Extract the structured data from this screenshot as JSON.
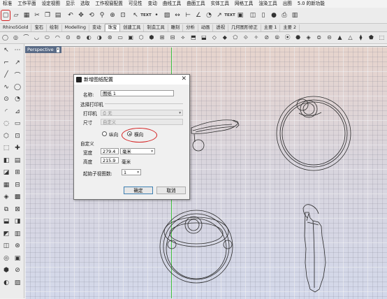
{
  "menubar": {
    "items": [
      "标准",
      "工作平面",
      "设定视图",
      "显示",
      "选取",
      "工作视窗配置",
      "可见性",
      "变动",
      "曲线工具",
      "曲面工具",
      "实体工具",
      "网格工具",
      "渲染工具",
      "出图",
      "5.0 的新功能"
    ]
  },
  "toolbar": {
    "buttons": [
      {
        "icon": "new-file-icon",
        "glyph": "▢"
      },
      {
        "icon": "open-file-icon",
        "glyph": "▱"
      },
      {
        "icon": "save-icon",
        "glyph": "▦"
      },
      {
        "icon": "cut-icon",
        "glyph": "✂"
      },
      {
        "icon": "copy-icon",
        "glyph": "❐"
      },
      {
        "icon": "paste-icon",
        "glyph": "▤"
      },
      {
        "icon": "undo-icon",
        "glyph": "↶"
      },
      {
        "icon": "pan-icon",
        "glyph": "✥"
      },
      {
        "icon": "rotate-view-icon",
        "glyph": "⟲"
      },
      {
        "icon": "zoom-icon",
        "glyph": "⚲"
      },
      {
        "icon": "zoom-extents-icon",
        "glyph": "⊕"
      },
      {
        "icon": "zoom-window-icon",
        "glyph": "⊡"
      },
      {
        "icon": "select-icon",
        "glyph": "↖"
      },
      {
        "icon": "text-icon",
        "glyph": "TEXT"
      },
      {
        "icon": "dot-icon",
        "glyph": "•"
      },
      {
        "icon": "hatch-icon",
        "glyph": "▨"
      },
      {
        "icon": "dimension-icon",
        "glyph": "↔"
      },
      {
        "icon": "linear-dimension-icon",
        "glyph": "⊢"
      },
      {
        "icon": "angle-icon",
        "glyph": "∠"
      },
      {
        "icon": "radius-icon",
        "glyph": "◔"
      },
      {
        "icon": "leader-icon",
        "glyph": "↗"
      },
      {
        "icon": "text-field-icon",
        "glyph": "TEXT"
      },
      {
        "icon": "block-icon",
        "glyph": "▣"
      },
      {
        "icon": "detail-icon",
        "glyph": "◫"
      },
      {
        "icon": "layout-icon",
        "glyph": "▯"
      },
      {
        "icon": "material-icon",
        "glyph": "●"
      },
      {
        "icon": "print-icon",
        "glyph": "⎙"
      },
      {
        "icon": "print-setup-icon",
        "glyph": "▥"
      }
    ]
  },
  "tabs": [
    "Rhino5Gold",
    "宝石",
    "绘制",
    "Modelling",
    "变动",
    "珠宝",
    "创建工具",
    "制造工具",
    "雕刻",
    "分析",
    "动画",
    "透视",
    "几何图形修正",
    "主要 1",
    "主要 2"
  ],
  "active_tab": "珠宝",
  "toolbar2": {
    "buttons": [
      "◯",
      "◎",
      "⌒",
      "◡",
      "⬭",
      "◠",
      "⊙",
      "⊚",
      "◐",
      "◑",
      "⊛",
      "▭",
      "▣",
      "⬡",
      "⬢",
      "⊞",
      "⊟",
      "⟡",
      "⬒",
      "⬓",
      "◇",
      "◆",
      "⬠",
      "⟐",
      "✧",
      "⊘",
      "⦾",
      "⦿",
      "⬣",
      "◈",
      "⊜",
      "⊝",
      "▲",
      "△",
      "⧫",
      "⬟",
      "⬚"
    ]
  },
  "lefttools": {
    "buttons": [
      "↖",
      "⋯",
      "⌐",
      "↗",
      "╱",
      "⌒",
      "∿",
      "◯",
      "⊙",
      "◔",
      "◜",
      "⊿",
      "◌",
      "▭",
      "⬡",
      "⊡",
      "⬚",
      "✚",
      "◧",
      "▤",
      "◪",
      "⊞",
      "▦",
      "⊟",
      "◈",
      "▩",
      "⧉",
      "⊠",
      "⬓",
      "◨",
      "◩",
      "▥",
      "◫",
      "⊛",
      "◎",
      "▣",
      "⬢",
      "⊘",
      "◐",
      "▨"
    ]
  },
  "viewport": {
    "label": "Perspective",
    "arrow": "▾"
  },
  "dialog": {
    "title": "新增图纸配置",
    "close": "✕",
    "name_label": "名称:",
    "name_value": "图纸 1",
    "printer_group": "选择打印机",
    "printer_label": "打印机",
    "printer_value": "无",
    "size_label": "尺寸",
    "size_value": "自定义",
    "portrait_label": "纵向",
    "landscape_label": "横向",
    "orientation_selected": "landscape",
    "custom_group": "自定义",
    "width_label": "宽度",
    "width_value": "279.4",
    "width_unit": "毫米",
    "height_label": "高度",
    "height_value": "215.9",
    "height_unit": "毫米",
    "detail_count_label": "起始子视图数:",
    "detail_count_value": "1",
    "ok_label": "确定",
    "cancel_label": "取消"
  },
  "colors": {
    "highlight": "#d42020",
    "viewport_label_bg": "#5a6b86",
    "y_axis": "#3fbf3f",
    "default_button_border": "#3c7fb1"
  }
}
